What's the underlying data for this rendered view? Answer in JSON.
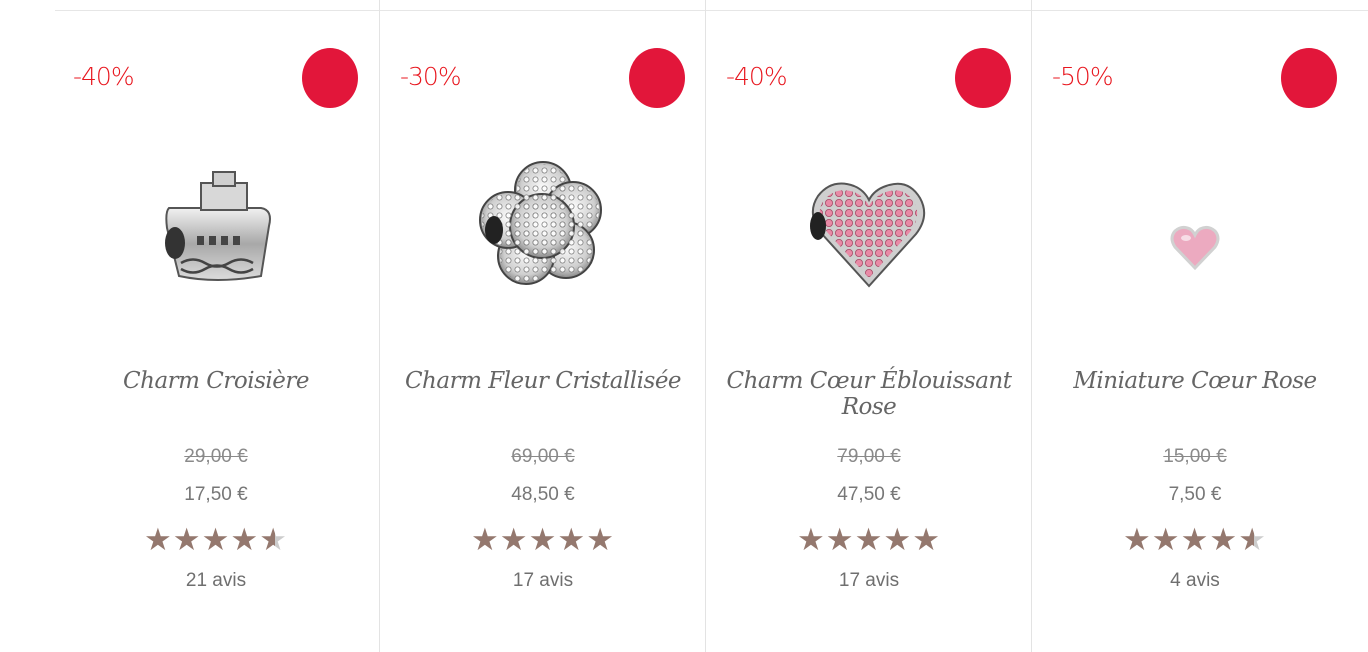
{
  "products": [
    {
      "discount": "-40%",
      "name": "Charm Croisière",
      "old_price": "29,00 €",
      "price": "17,50 €",
      "rating": 4.5,
      "reviews": "21 avis",
      "icon": "ship-charm-icon"
    },
    {
      "discount": "-30%",
      "name": "Charm Fleur Cristallisée",
      "old_price": "69,00 €",
      "price": "48,50 €",
      "rating": 5,
      "reviews": "17 avis",
      "icon": "crystal-flower-charm-icon"
    },
    {
      "discount": "-40%",
      "name": "Charm Cœur Éblouissant Rose",
      "old_price": "79,00 €",
      "price": "47,50 €",
      "rating": 5,
      "reviews": "17 avis",
      "icon": "pink-heart-pave-charm-icon"
    },
    {
      "discount": "-50%",
      "name": "Miniature Cœur Rose",
      "old_price": "15,00 €",
      "price": "7,50 €",
      "rating": 4.5,
      "reviews": "4 avis",
      "icon": "mini-pink-heart-charm-icon"
    }
  ],
  "colors": {
    "discount": "#e8171f",
    "wishlist": "#e2163a",
    "star": "#94786e"
  }
}
